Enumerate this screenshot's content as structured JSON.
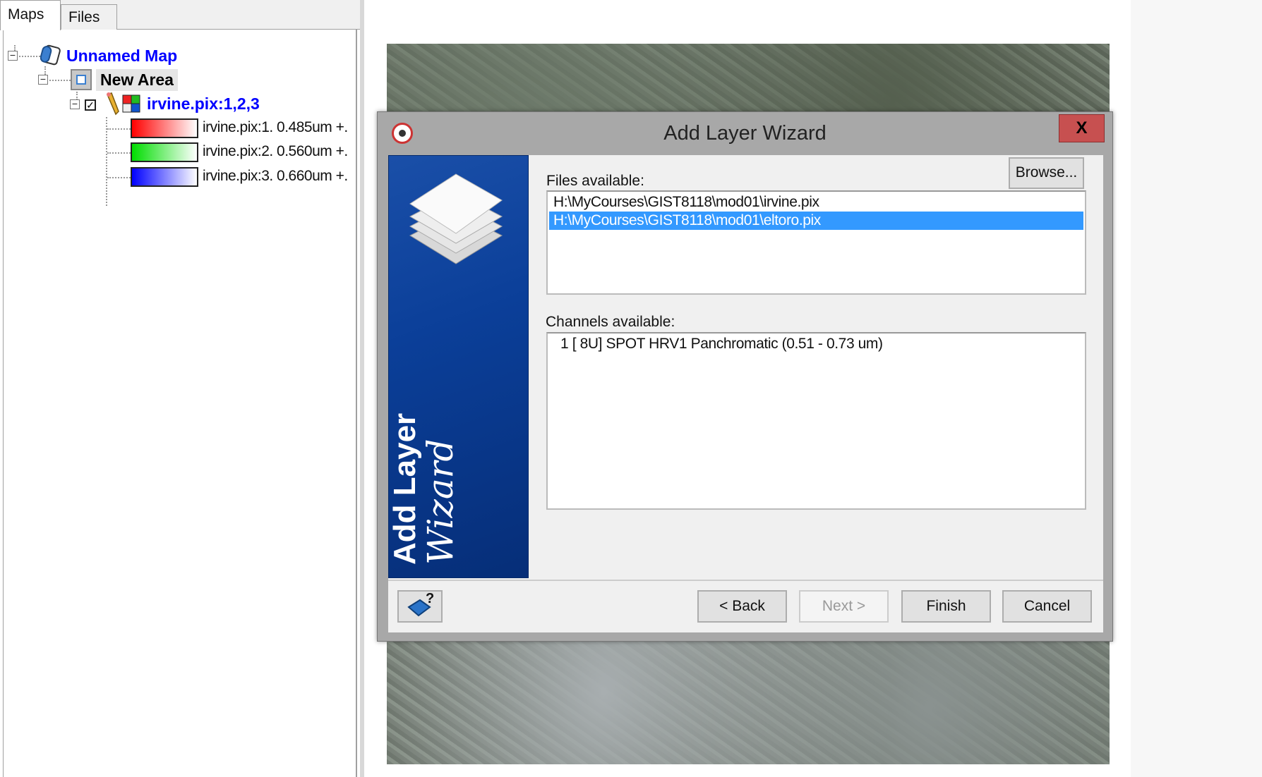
{
  "left_panel": {
    "tabs": [
      {
        "label": "Maps",
        "active": true
      },
      {
        "label": "Files",
        "active": false
      }
    ],
    "tree": {
      "map": {
        "label": "Unnamed Map",
        "icon": "map-scroll-icon",
        "color": "#0000ff"
      },
      "area": {
        "label": "New Area",
        "icon": "area-frame-icon"
      },
      "layer": {
        "label": "irvine.pix:1,2,3",
        "checked": true,
        "color": "#0000ff",
        "icons": [
          "pencil-icon",
          "rgb-grid-icon"
        ]
      },
      "bands": [
        {
          "label": "irvine.pix:1. 0.485um +.",
          "color": "#ff0000"
        },
        {
          "label": "irvine.pix:2. 0.560um +.",
          "color": "#00ff00"
        },
        {
          "label": "irvine.pix:3. 0.660um +.",
          "color": "#0000ff"
        }
      ]
    }
  },
  "dialog": {
    "title": "Add Layer Wizard",
    "close_label": "X",
    "banner": {
      "line1": "Add Layer",
      "line2": "Wizard"
    },
    "files_label": "Files available:",
    "browse_label": "Browse...",
    "files": [
      {
        "path": "H:\\MyCourses\\GIST8118\\mod01\\irvine.pix",
        "selected": false
      },
      {
        "path": "H:\\MyCourses\\GIST8118\\mod01\\eltoro.pix",
        "selected": true
      }
    ],
    "channels_label": "Channels available:",
    "channels": [
      "1 [ 8U] SPOT HRV1 Panchromatic (0.51 - 0.73 um)"
    ],
    "buttons": {
      "help_icon": "help-book-icon",
      "back": "< Back",
      "next": "Next >",
      "finish": "Finish",
      "cancel": "Cancel"
    },
    "selection_color": "#3399ff",
    "close_color": "#c75050"
  }
}
